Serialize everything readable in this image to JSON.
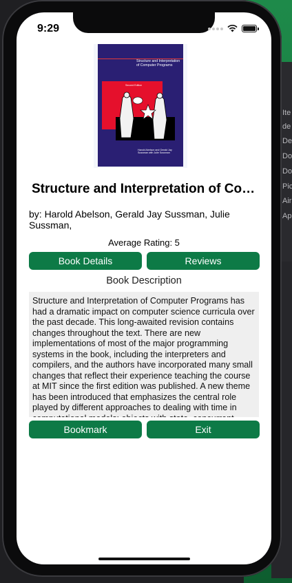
{
  "status_bar": {
    "time": "9:29"
  },
  "book": {
    "cover": {
      "title": "Structure and Interpretation of Computer Programs",
      "edition": "Second Edition",
      "authors": "Harold Abelson and Gerald Jay Sussman with Julie Sussman"
    },
    "title": "Structure and Interpretation of Computer Programs",
    "authors": "by: Harold Abelson, Gerald Jay Sussman, Julie Sussman,",
    "rating_text": "Average Rating: 5",
    "description_heading": "Book Description",
    "description": "Structure and Interpretation of Computer Programs has had a dramatic impact on computer science curricula over the past decade. This long-awaited revision contains changes throughout the text. There are new implementations of most of the major programming systems in the book, including the interpreters and compilers, and the authors have incorporated many small changes that reflect their experience teaching the course at MIT since the first edition was published. A new theme has been introduced that emphasizes the central role played by different approaches to dealing with time in computational models: objects with state, concurrent programming, functional programming and lazy evaluation, and nondeterministic programming."
  },
  "buttons": {
    "book_details": "Book Details",
    "reviews": "Reviews",
    "bookmark": "Bookmark",
    "exit": "Exit"
  },
  "colors": {
    "accent": "#0d7a46",
    "description_bg": "#efefef"
  },
  "background": {
    "side_texts": [
      "Ite",
      "de",
      "De",
      "Do",
      "Do",
      "Pic",
      "Air",
      "Ap"
    ]
  }
}
